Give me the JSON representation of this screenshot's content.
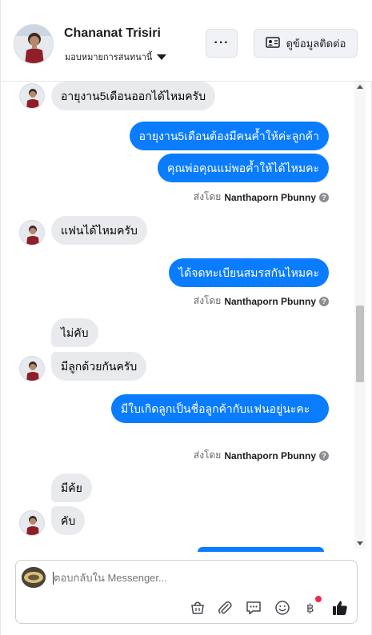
{
  "header": {
    "name": "Chananat Trisiri",
    "subtitle": "มอบหมายการสนทนานี้",
    "more_label": "···",
    "contact_label": "ดูข้อมูลติดต่อ"
  },
  "messages": {
    "m1": "อายุงาน5เดือนออกได้ไหมครับ",
    "m2": "อายุงาน5เดือนต้องมีคนค้ำให้ค่ะลูกค้า",
    "m3": "คุณพ่อคุณแม่พอค้ำให้ได้ไหมคะ",
    "m4": "แฟนได้ไหมครับ",
    "m5": "ได้จดทะเบียนสมรสกันไหมคะ",
    "m6": "ไม่คับ",
    "m7": "มีลูกด้วยกันครับ",
    "m8": "มีใบเกิดลูกเป็นชื่อลูกค้ากับแฟนอยู่นะคะ",
    "m9": "มีค้ย",
    "m10": "คับ"
  },
  "sent_by": {
    "prefix": "ส่งโดย",
    "agent": "Nanthaporn Pbunny",
    "help": "?"
  },
  "composer": {
    "placeholder": "ตอบกลับใน Messenger..."
  },
  "colors": {
    "outgoing": "#0a7cff",
    "incoming": "#e9eaed",
    "like": "#1c1e21"
  },
  "icons": [
    "more-icon",
    "contact-card-icon",
    "caret-down-icon",
    "help-icon",
    "bag-icon",
    "attach-icon",
    "saved-reply-icon",
    "emoji-icon",
    "baht-icon",
    "like-icon"
  ]
}
